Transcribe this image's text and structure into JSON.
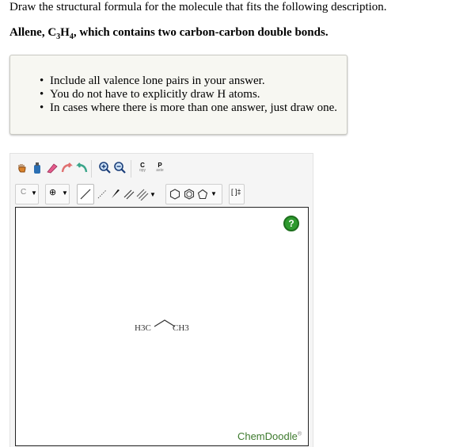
{
  "question": {
    "line1": "Draw the structural formula for the molecule that fits the following description.",
    "line2_prefix": "Allene, C",
    "line2_sub1": "3",
    "line2_mid": "H",
    "line2_sub2": "4",
    "line2_suffix": ", which contains two carbon-carbon double bonds."
  },
  "notes": [
    "Include all valence lone pairs in your answer.",
    "You do not have to explicitly draw H atoms.",
    "In cases where there is more than one answer, just draw one."
  ],
  "toolbar": {
    "copy_label_top": "C",
    "copy_label_bottom": "opy",
    "paste_label_top": "P",
    "paste_label_bottom": "aste",
    "element_label": "C",
    "charge_label": "⊕",
    "bracket_label": "[ ]‡"
  },
  "canvas": {
    "help_label": "?",
    "left_label": "H3C",
    "right_label": "CH3",
    "brand": "ChemDoodle",
    "brand_mark": "®"
  },
  "icons": [
    "hand-icon",
    "lasso-icon",
    "eraser-icon",
    "clear-icon",
    "undo-icon",
    "redo-icon",
    "zoom-in-icon",
    "zoom-out-icon",
    "single-bond-icon",
    "bond-stereo-icon",
    "wedge-bond-icon",
    "double-bond-icon",
    "triple-bond-icon",
    "ring-icon",
    "benzene-icon",
    "pentagon-icon",
    "help-icon"
  ]
}
